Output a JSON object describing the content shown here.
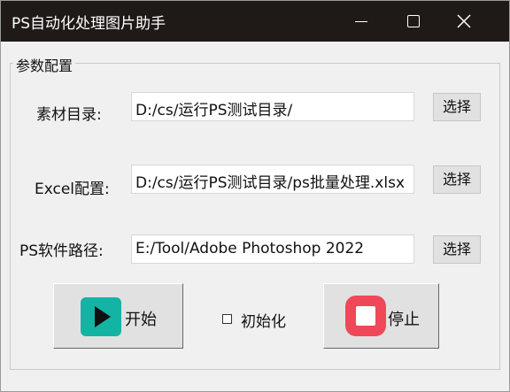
{
  "window": {
    "title": "PS自动化处理图片助手",
    "controls": [
      "minimize-icon",
      "maximize-icon",
      "close-icon"
    ]
  },
  "group": {
    "label": "参数配置"
  },
  "rows": [
    {
      "label": "素材目录:",
      "value": "D:/cs/运行PS测试目录/",
      "button": "选择"
    },
    {
      "label": "Excel配置:",
      "value": "D:/cs/运行PS测试目录/ps批量处理.xlsx",
      "button": "选择"
    },
    {
      "label": "PS软件路径:",
      "value": "E:/Tool/Adobe Photoshop 2022",
      "button": "选择"
    }
  ],
  "actions": {
    "start_label": "开始",
    "start_icon": "play-icon",
    "stop_label": "停止",
    "stop_icon": "stop-icon",
    "init_checkbox_label": "初始化",
    "init_checked": false
  },
  "colors": {
    "titlebar": "#1f1a17",
    "start_icon_bg": "#14b4a5",
    "stop_icon_bg": "#f04858"
  }
}
